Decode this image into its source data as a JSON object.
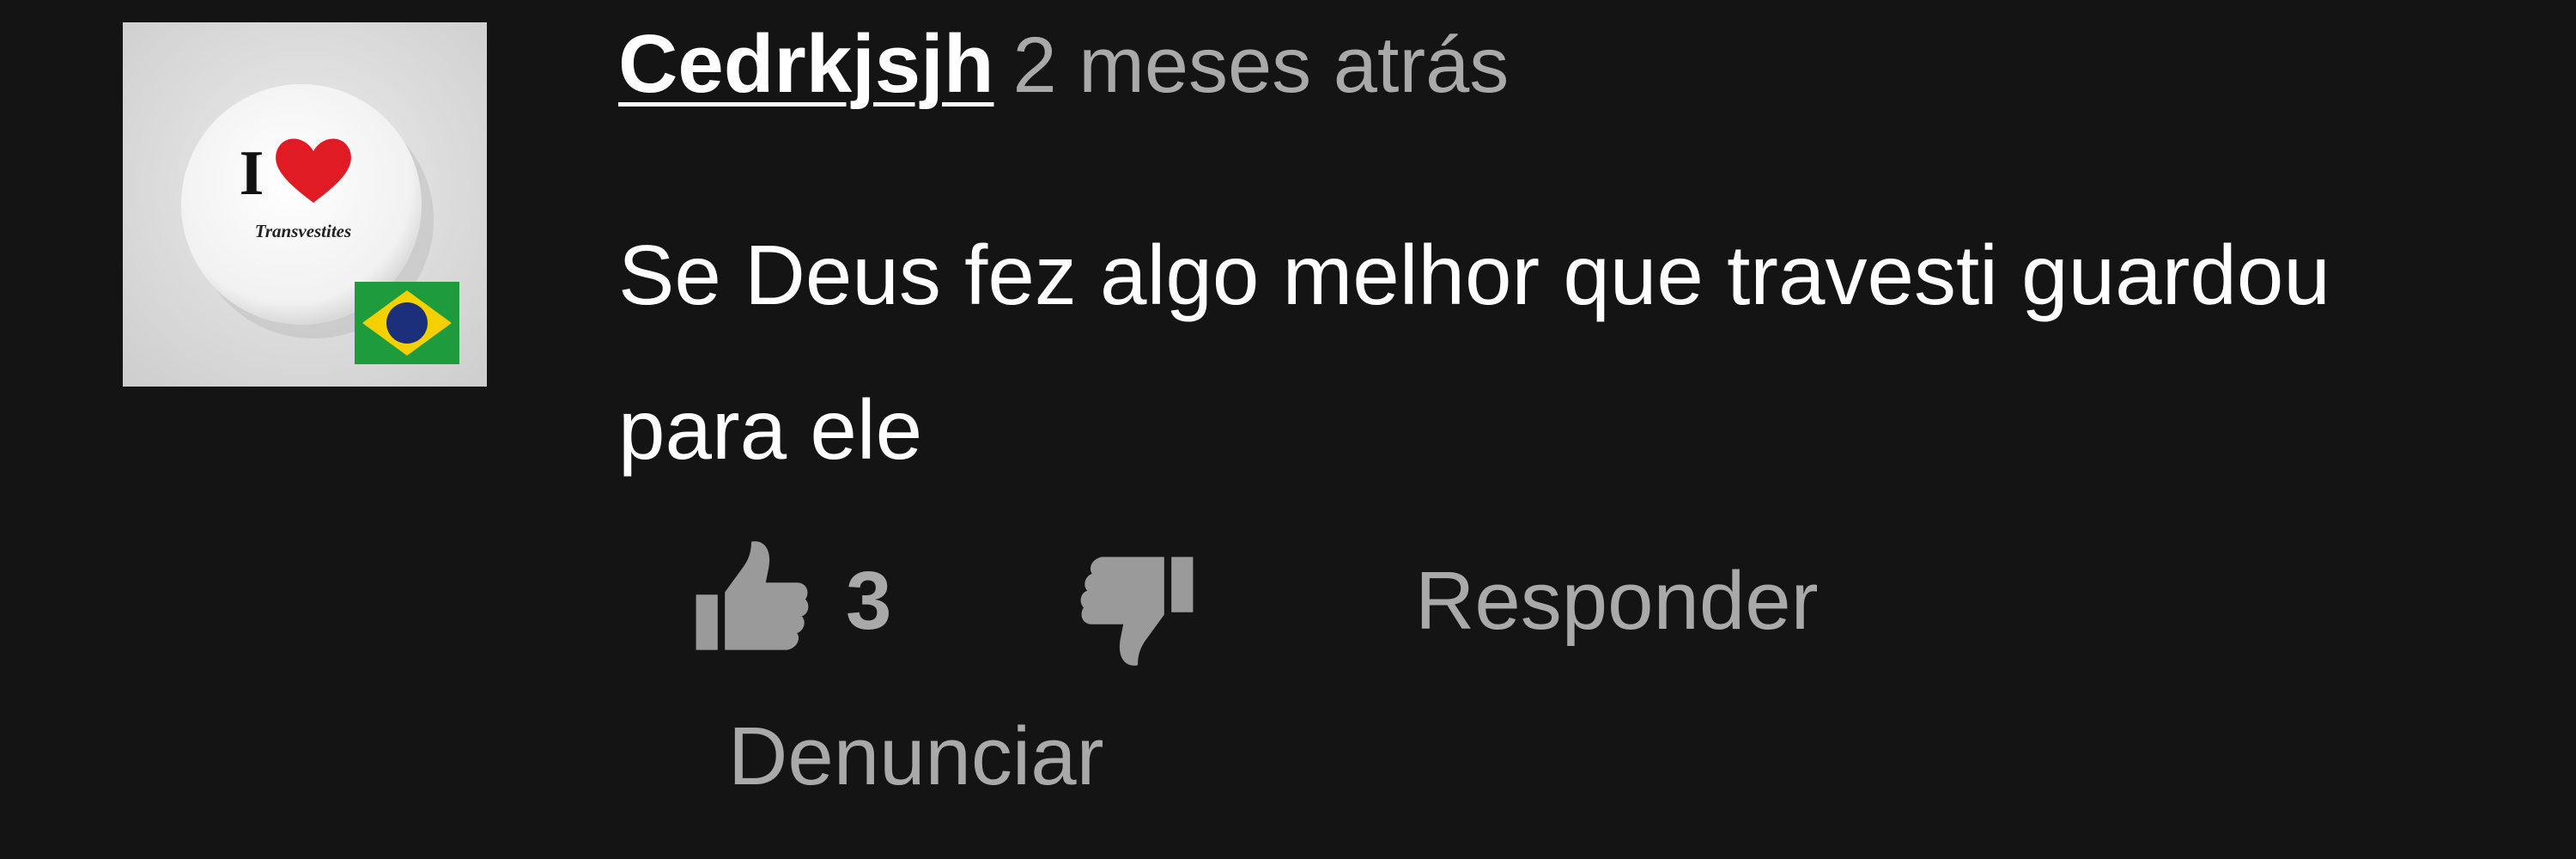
{
  "comment": {
    "author": "Cedrkjsjh",
    "timestamp": "2 meses atrás",
    "text": "Se Deus fez algo melhor que travesti guardou para ele",
    "avatar": {
      "icon": "i-love-button-badge-icon",
      "badge_text_big": "I",
      "badge_text_small": "Transvestites",
      "flag_icon": "brazil-flag-icon",
      "heart_color": "#e01b24"
    },
    "actions": {
      "like_icon": "thumbs-up-icon",
      "like_count": "3",
      "dislike_icon": "thumbs-down-icon",
      "reply_label": "Responder",
      "report_label": "Denunciar"
    }
  },
  "colors": {
    "background": "#141414",
    "primary_text": "#ffffff",
    "secondary_text": "#a9a9a9"
  }
}
